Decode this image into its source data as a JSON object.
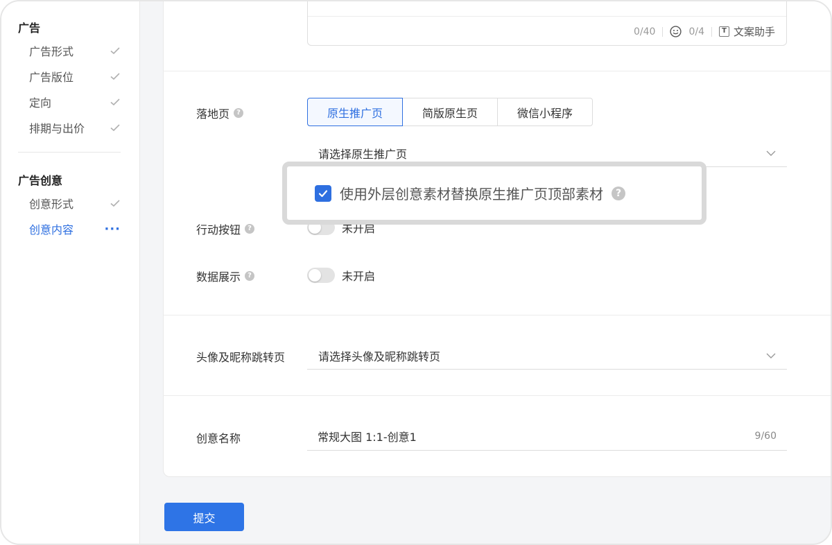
{
  "sidebar": {
    "groups": [
      {
        "title": "广告",
        "items": [
          {
            "label": "广告形式"
          },
          {
            "label": "广告版位"
          },
          {
            "label": "定向"
          },
          {
            "label": "排期与出价"
          }
        ]
      },
      {
        "title": "广告创意",
        "items": [
          {
            "label": "创意形式"
          },
          {
            "label": "创意内容"
          }
        ]
      }
    ],
    "more_glyph": "···",
    "colors": {
      "active": "#2e6fe0",
      "check": "#b0b0b0"
    }
  },
  "text_area": {
    "text_count": "0/40",
    "emoji_count": "0/4",
    "helper_label": "文案助手",
    "helper_icon_glyph": "T"
  },
  "landing_page": {
    "label": "落地页",
    "tabs": [
      {
        "label": "原生推广页",
        "active": true
      },
      {
        "label": "简版原生页",
        "active": false
      },
      {
        "label": "微信小程序",
        "active": false
      }
    ],
    "select_placeholder": "请选择原生推广页"
  },
  "callout": {
    "checkbox_label": "使用外层创意素材替换原生推广页顶部素材",
    "checked": true
  },
  "action_button": {
    "label": "行动按钮",
    "status": "未开启"
  },
  "data_display": {
    "label": "数据展示",
    "status": "未开启"
  },
  "avatar_jump": {
    "label": "头像及昵称跳转页",
    "select_placeholder": "请选择头像及昵称跳转页"
  },
  "creative_name": {
    "label": "创意名称",
    "value": "常规大图 1:1-创意1",
    "count": "9/60"
  },
  "help_glyph": "?",
  "submit_label": "提交",
  "colors": {
    "primary": "#2e74e6",
    "border": "#dcdcdc"
  }
}
